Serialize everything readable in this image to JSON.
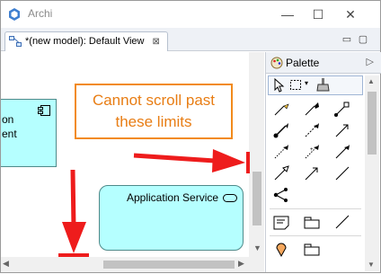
{
  "window": {
    "app_title": "Archi",
    "minimize_glyph": "—",
    "maximize_glyph": "☐",
    "close_glyph": "✕"
  },
  "editor": {
    "tab_label": "*(new model): Default View",
    "tab_close_glyph": "⊠",
    "minimize_glyph": "▭",
    "maximize_glyph": "▢"
  },
  "canvas": {
    "partial_component_label": "on\nent",
    "service_label": "Application Service"
  },
  "annotation": {
    "callout_text": "Cannot scroll past these limits"
  },
  "palette": {
    "title": "Palette",
    "collapse_glyph": "▷",
    "selected_tool": "select-tool"
  },
  "colors": {
    "element_fill": "#b5ffff",
    "callout_border": "#f28a1c",
    "callout_text": "#e87d14",
    "annotation_arrow": "#ee1c1c"
  }
}
